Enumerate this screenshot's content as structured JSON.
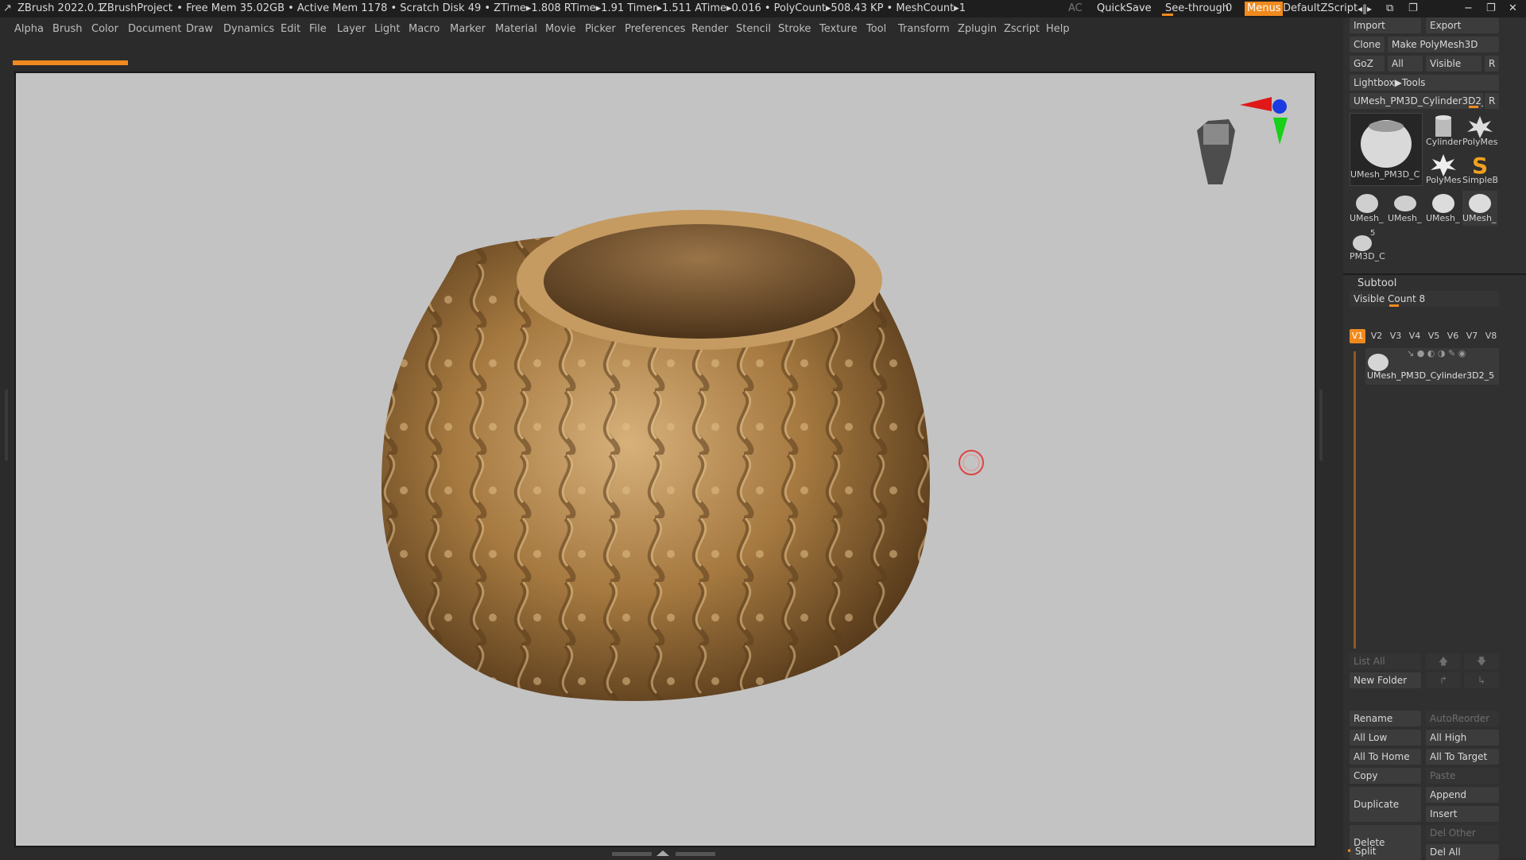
{
  "titlebar": {
    "app": "ZBrush 2022.0.1",
    "project": "ZBrushProject",
    "stats": ". • Free Mem 35.02GB • Active Mem 1178 • Scratch Disk 49 •  ZTime▸1.808 RTime▸1.91 Timer▸1.511 ATime▸0.016 • PolyCount▸508.43 KP  • MeshCount▸1",
    "ac": "AC",
    "quicksave": "QuickSave",
    "seethrough_label": "See-through",
    "seethrough_value": "0",
    "menus": "Menus",
    "script": "DefaultZScript"
  },
  "menubar": [
    "Alpha",
    "Brush",
    "Color",
    "Document",
    "Draw",
    "Dynamics",
    "Edit",
    "File",
    "Layer",
    "Light",
    "Macro",
    "Marker",
    "Material",
    "Movie",
    "Picker",
    "Preferences",
    "Render",
    "Stencil",
    "Stroke",
    "Texture",
    "Tool",
    "Transform",
    "Zplugin",
    "Zscript",
    "Help"
  ],
  "progress": {
    "value": 0.08
  },
  "colors": {
    "accent": "#f08a1f",
    "viewport_bg": "#c3c3c3",
    "bronze": "#a4783f"
  },
  "tool": {
    "import": "Import",
    "export": "Export",
    "clone": "Clone",
    "make_polymesh": "Make PolyMesh3D",
    "goz": "GoZ",
    "all": "All",
    "visible": "Visible",
    "r": "R",
    "lightbox": "Lightbox▶Tools",
    "current_tool": "UMesh_PM3D_Cylinder3D2_5",
    "current_r": "R",
    "thumbs": [
      {
        "cap": "UMesh_PM3D_C"
      },
      {
        "cap": "Cylinder"
      },
      {
        "cap": "PolyMes"
      },
      {
        "cap": "PolyMes"
      },
      {
        "cap": "SimpleB"
      },
      {
        "cap": "UMesh_"
      },
      {
        "cap": "UMesh_"
      },
      {
        "cap": "UMesh_"
      },
      {
        "cap": "UMesh_"
      },
      {
        "cap": "PM3D_C",
        "badge": "5"
      }
    ]
  },
  "subtool": {
    "title": "Subtool",
    "visible_count": "Visible Count 8",
    "tabs": [
      "V1",
      "V2",
      "V3",
      "V4",
      "V5",
      "V6",
      "V7",
      "V8"
    ],
    "item_name": "UMesh_PM3D_Cylinder3D2_5",
    "list_all": "List All",
    "new_folder": "New Folder",
    "rename": "Rename",
    "autoreorder": "AutoReorder",
    "all_low": "All Low",
    "all_high": "All High",
    "all_to_home": "All To Home",
    "all_to_target": "All To Target",
    "copy": "Copy",
    "paste": "Paste",
    "duplicate": "Duplicate",
    "append": "Append",
    "insert": "Insert",
    "delete": "Delete",
    "del_other": "Del Other",
    "del_all": "Del All",
    "split": "Split"
  }
}
